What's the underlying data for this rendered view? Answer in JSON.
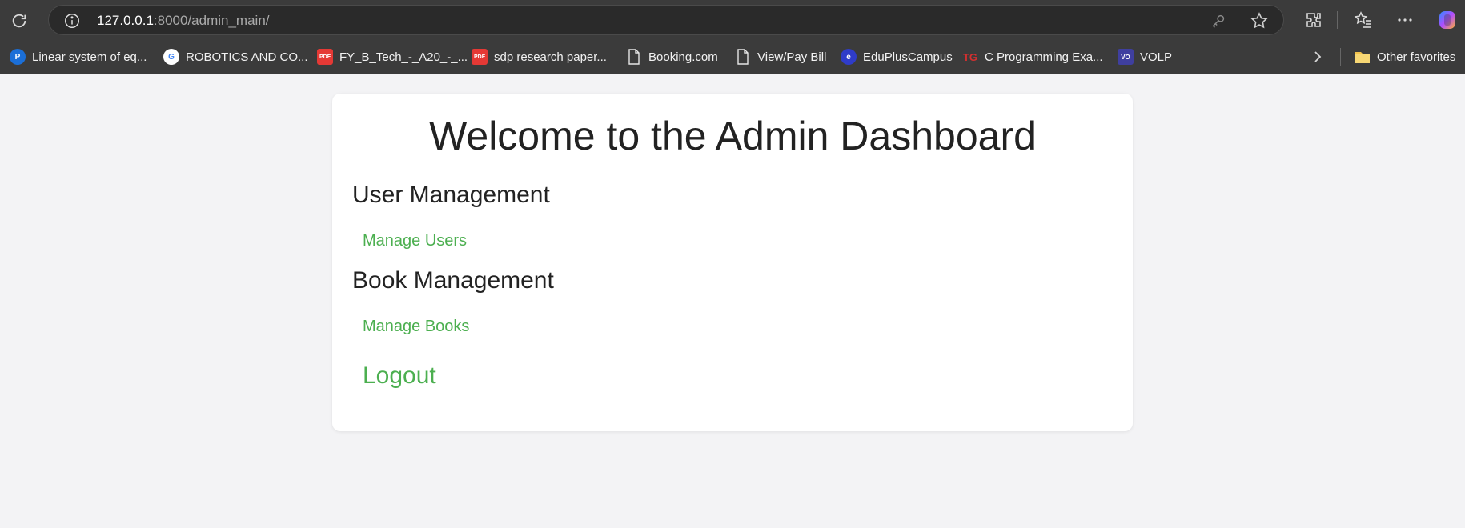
{
  "browser": {
    "url_host": "127.0.0.1",
    "url_rest": ":8000/admin_main/",
    "bookmarks": [
      {
        "label": "Linear system of eq...",
        "icon": "pearson-icon"
      },
      {
        "label": "ROBOTICS AND CO...",
        "icon": "google-icon"
      },
      {
        "label": "FY_B_Tech_-_A20_-_...",
        "icon": "pdf-icon"
      },
      {
        "label": "sdp research paper...",
        "icon": "pdf-icon"
      },
      {
        "label": "Booking.com",
        "icon": "page-icon"
      },
      {
        "label": "View/Pay Bill",
        "icon": "page-icon"
      },
      {
        "label": "EduPlusCampus",
        "icon": "eduplus-icon"
      },
      {
        "label": "C Programming Exa...",
        "icon": "tg-icon"
      },
      {
        "label": "VOLP",
        "icon": "volp-icon"
      }
    ],
    "other_favorites": "Other favorites"
  },
  "page": {
    "title": "Welcome to the Admin Dashboard",
    "sections": [
      {
        "heading": "User Management",
        "link": "Manage Users"
      },
      {
        "heading": "Book Management",
        "link": "Manage Books"
      }
    ],
    "logout": "Logout"
  },
  "colors": {
    "link": "#4caf50",
    "chrome_bg": "#3b3b3b",
    "page_bg": "#f3f3f5"
  }
}
